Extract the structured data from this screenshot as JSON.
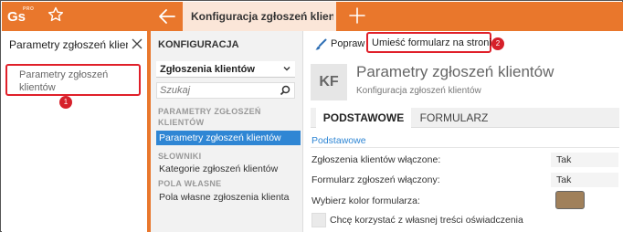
{
  "topbar": {
    "logo_text": "Gs",
    "logo_badge": "PRO",
    "active_tab_title": "Konfiguracja zgłoszeń klient"
  },
  "left": {
    "title": "Parametry zgłoszeń klien",
    "item_label": "Parametry zgłoszeń klientów"
  },
  "badges": {
    "one": "1",
    "two": "2"
  },
  "nav": {
    "title": "KONFIGURACJA",
    "select_value": "Zgłoszenia klientów",
    "search_placeholder": "Szukaj",
    "section1": "PARAMETRY ZGŁOSZEŃ KLIENTÓW",
    "link1": "Parametry zgłoszeń klientów",
    "section2": "SŁOWNIKI",
    "link2": "Kategorie zgłoszeń klientów",
    "section3": "POLA WŁASNE",
    "link3": "Pola własne zgłoszenia klienta"
  },
  "toolbar": {
    "poprav_label": "Popraw",
    "place_form_label": "Umieść formularz na stronie"
  },
  "content": {
    "kf_initials": "KF",
    "title": "Parametry zgłoszeń klientów",
    "subtitle": "Konfiguracja zgłoszeń klientów",
    "tab_basic": "PODSTAWOWE",
    "tab_form": "FORMULARZ",
    "section_label": "Podstawowe",
    "field1_label": "Zgłoszenia klientów włączone:",
    "field1_value": "Tak",
    "field2_label": "Formularz zgłoszeń włączony:",
    "field2_value": "Tak",
    "field3_label": "Wybierz kolor formularza:",
    "field3_color": "#a0805a",
    "checkbox_label": "Chcę korzystać z własnej treści oświadczenia"
  },
  "colors": {
    "accent": "#e9772c",
    "highlight_blue": "#2f86d4",
    "marker_red": "#d6202a"
  },
  "icons": [
    "star-icon",
    "back-arrow-icon",
    "plus-icon",
    "close-icon",
    "chevron-down-icon",
    "search-icon",
    "brush-icon"
  ]
}
